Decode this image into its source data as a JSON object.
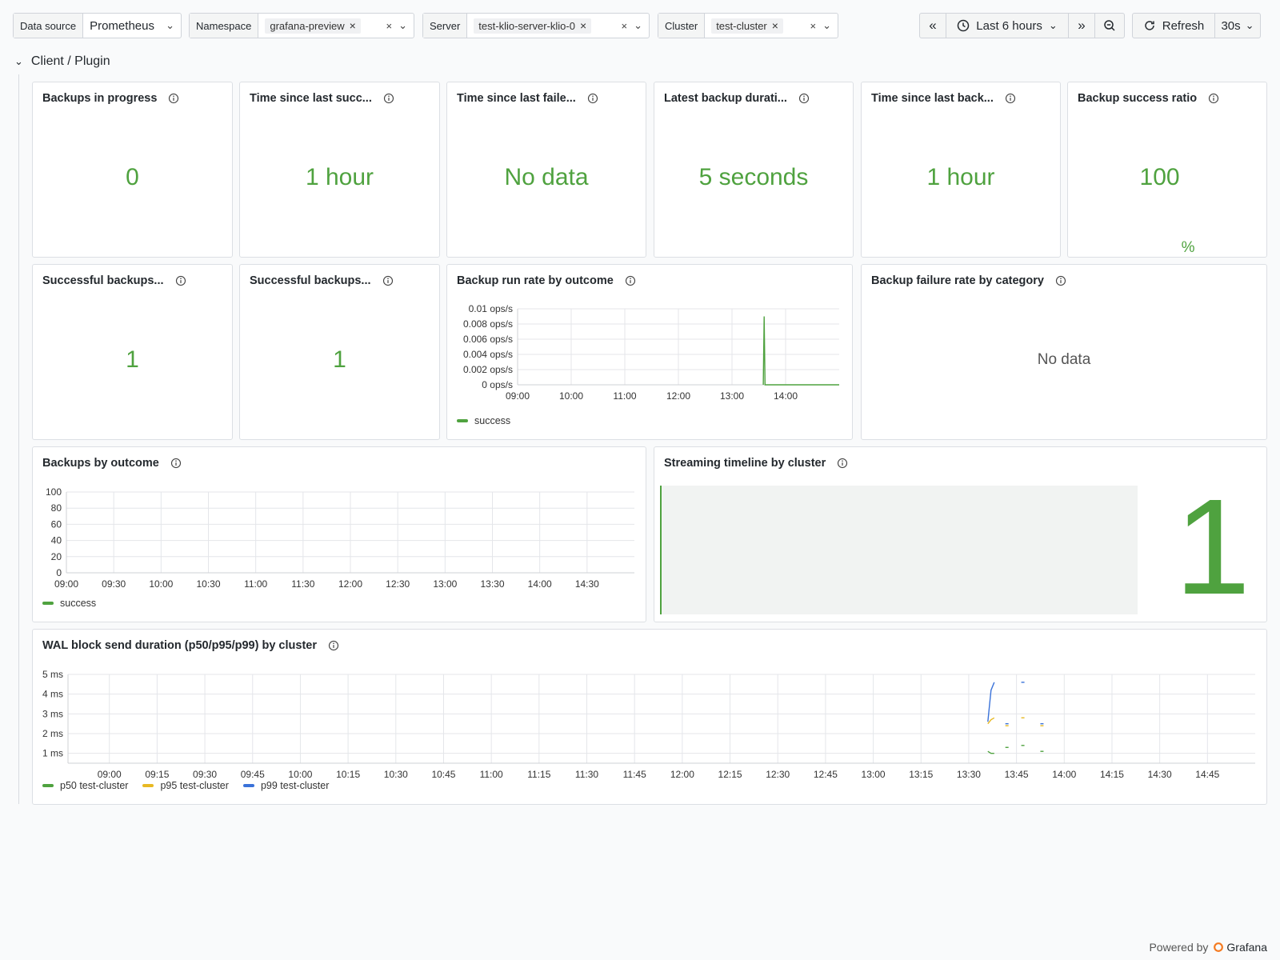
{
  "variables": {
    "datasource": {
      "label": "Data source",
      "value": "Prometheus"
    },
    "namespace": {
      "label": "Namespace",
      "value": "grafana-preview"
    },
    "server": {
      "label": "Server",
      "value": "test-klio-server-klio-0"
    },
    "cluster": {
      "label": "Cluster",
      "value": "test-cluster"
    }
  },
  "timepicker": {
    "range": "Last 6 hours",
    "refresh_label": "Refresh",
    "interval": "30s"
  },
  "row": {
    "title": "Client / Plugin"
  },
  "panels": {
    "p1": {
      "title": "Backups in progress",
      "value": "0"
    },
    "p2": {
      "title": "Time since last succ...",
      "value": "1 hour"
    },
    "p3": {
      "title": "Time since last faile...",
      "value": "No data"
    },
    "p4": {
      "title": "Latest backup durati...",
      "value": "5 seconds"
    },
    "p5": {
      "title": "Time since last back...",
      "value": "1 hour"
    },
    "p6": {
      "title": "Backup success ratio",
      "value": "100",
      "unit": "%"
    },
    "p7": {
      "title": "Successful backups...",
      "value": "1"
    },
    "p8": {
      "title": "Successful backups...",
      "value": "1"
    },
    "p9": {
      "title": "Backup run rate by outcome"
    },
    "p10": {
      "title": "Backup failure rate by category",
      "nodata": "No data"
    },
    "p11": {
      "title": "Backups by outcome"
    },
    "p12": {
      "title": "Streaming timeline by cluster",
      "big_value": "1"
    },
    "p13": {
      "title": "WAL block send duration (p50/p95/p99) by cluster"
    }
  },
  "colors": {
    "green": "#4fa23f",
    "yellow": "#e8b923",
    "blue": "#3a72d9"
  },
  "footer": {
    "powered": "Powered by",
    "brand": "Grafana"
  },
  "chart_data": [
    {
      "type": "line",
      "title": "Backup run rate by outcome",
      "y_ticks": [
        "0 ops/s",
        "0.002 ops/s",
        "0.004 ops/s",
        "0.006 ops/s",
        "0.008 ops/s",
        "0.01 ops/s"
      ],
      "ylim": [
        0,
        0.01
      ],
      "x_ticks": [
        "09:00",
        "10:00",
        "11:00",
        "12:00",
        "13:00",
        "14:00"
      ],
      "series": [
        {
          "name": "success",
          "x": [
            "13:35",
            "13:36",
            "13:37",
            "15:00"
          ],
          "values": [
            0,
            0.009,
            0,
            0
          ]
        }
      ]
    },
    {
      "type": "line",
      "title": "Backups by outcome",
      "y_ticks": [
        "0",
        "20",
        "40",
        "60",
        "80",
        "100"
      ],
      "ylim": [
        0,
        100
      ],
      "x_ticks": [
        "09:00",
        "09:30",
        "10:00",
        "10:30",
        "11:00",
        "11:30",
        "12:00",
        "12:30",
        "13:00",
        "13:30",
        "14:00",
        "14:30"
      ],
      "series": [
        {
          "name": "success",
          "values": []
        }
      ]
    },
    {
      "type": "line",
      "title": "WAL block send duration (p50/p95/p99) by cluster",
      "y_ticks": [
        "1 ms",
        "2 ms",
        "3 ms",
        "4 ms",
        "5 ms"
      ],
      "ylim": [
        0.5,
        5
      ],
      "x_ticks": [
        "09:00",
        "09:15",
        "09:30",
        "09:45",
        "10:00",
        "10:15",
        "10:30",
        "10:45",
        "11:00",
        "11:15",
        "11:30",
        "11:45",
        "12:00",
        "12:15",
        "12:30",
        "12:45",
        "13:00",
        "13:15",
        "13:30",
        "13:45",
        "14:00",
        "14:15",
        "14:30",
        "14:45"
      ],
      "series": [
        {
          "name": "p50 test-cluster",
          "x": [
            "13:36",
            "13:37",
            "13:38"
          ],
          "values": [
            1.1,
            1.0,
            1.0
          ]
        },
        {
          "name": "p95 test-cluster",
          "x": [
            "13:36",
            "13:37",
            "13:38"
          ],
          "values": [
            2.5,
            2.7,
            2.8
          ]
        },
        {
          "name": "p99 test-cluster",
          "x": [
            "13:36",
            "13:37",
            "13:38"
          ],
          "values": [
            2.6,
            4.2,
            4.6
          ]
        }
      ]
    }
  ]
}
